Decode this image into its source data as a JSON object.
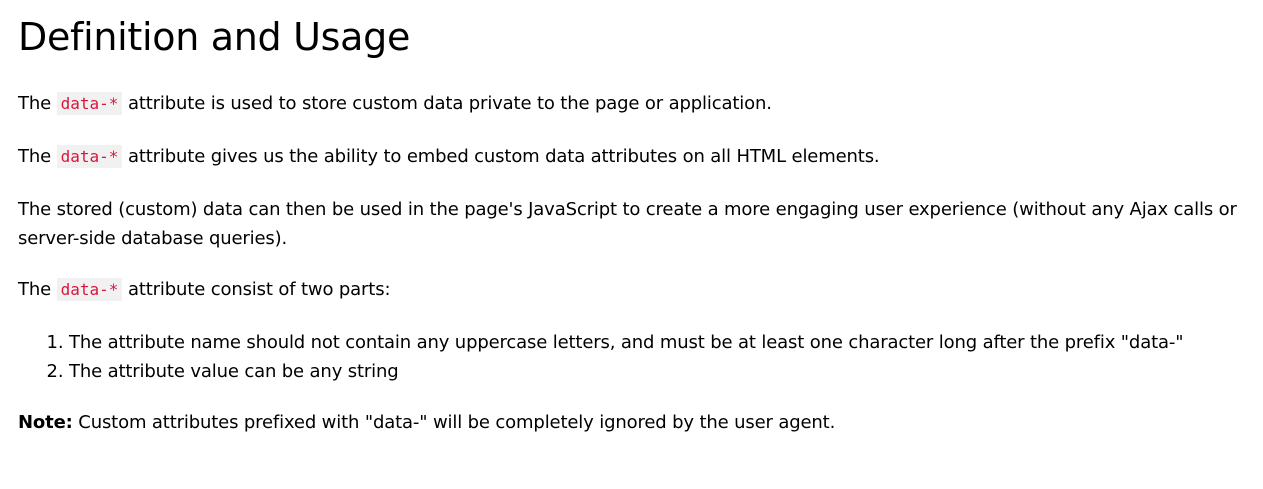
{
  "heading": "Definition and Usage",
  "paragraphs": [
    {
      "before": "The ",
      "code": "data-*",
      "after": " attribute is used to store custom data private to the page or application."
    },
    {
      "before": "The ",
      "code": "data-*",
      "after": " attribute gives us the ability to embed custom data attributes on all HTML elements."
    }
  ],
  "paragraph_plain": "The stored (custom) data can then be used in the page's JavaScript to create a more engaging user experience (without any Ajax calls or server-side database queries).",
  "parts_intro": {
    "before": "The ",
    "code": "data-*",
    "after": " attribute consist of two parts:"
  },
  "list_items": [
    "The attribute name should not contain any uppercase letters, and must be at least one character long after the prefix \"data-\"",
    "The attribute value can be any string"
  ],
  "note": {
    "label": "Note:",
    "text": " Custom attributes prefixed with \"data-\" will be completely ignored by the user agent."
  },
  "colors": {
    "code_text": "#dc143c",
    "code_background": "#f1f1f1"
  }
}
